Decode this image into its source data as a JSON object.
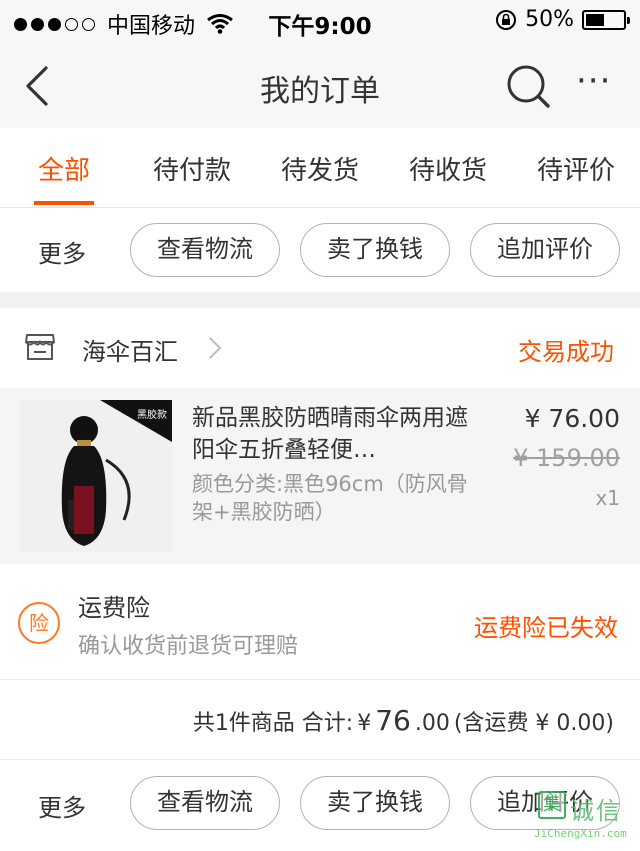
{
  "status_bar": {
    "carrier": "中国移动",
    "time": "下午9:00",
    "battery_text": "50%",
    "battery_level": 0.5,
    "signal_bars_filled": 3,
    "signal_bars_total": 5
  },
  "nav": {
    "title": "我的订单",
    "back_icon": "chevron-left-icon",
    "search_icon": "search-icon",
    "more_icon": "more-dots-icon",
    "more_text": "···"
  },
  "tabs": [
    {
      "label": "全部",
      "active": true
    },
    {
      "label": "待付款",
      "active": false
    },
    {
      "label": "待发货",
      "active": false
    },
    {
      "label": "待收货",
      "active": false
    },
    {
      "label": "待评价",
      "active": false
    }
  ],
  "top_actions": {
    "more": "更多",
    "logistics": "查看物流",
    "resell": "卖了换钱",
    "add_review": "追加评价"
  },
  "order": {
    "shop_name": "海伞百汇",
    "status": "交易成功",
    "item": {
      "title": "新品黑胶防晒晴雨伞两用遮阳伞五折叠轻便…",
      "sku": "颜色分类:黑色96cm（防风骨架+黑胶防晒）",
      "price": "¥ 76.00",
      "original_price": "¥ 159.00",
      "quantity": "x1",
      "thumb_badge": "黑胶款"
    },
    "insurance": {
      "icon_text": "险",
      "title": "运费险",
      "subtitle": "确认收货前退货可理赔",
      "status": "运费险已失效"
    },
    "summary": {
      "count_text": "共1件商品 合计:",
      "currency": "¥",
      "amount_int": "76",
      "amount_dec": ".00",
      "shipping_text": "(含运费 ¥ 0.00)"
    }
  },
  "bottom_actions": {
    "more": "更多",
    "logistics": "查看物流",
    "resell": "卖了换钱",
    "add_review": "追加评价"
  },
  "watermark": {
    "icon_char": "集",
    "text": "诚信",
    "url": "JiChengXin.com"
  },
  "colors": {
    "accent": "#ff5000",
    "insurance_icon": "#ff7a2b",
    "muted": "#999999",
    "background": "#f2f2f2"
  }
}
